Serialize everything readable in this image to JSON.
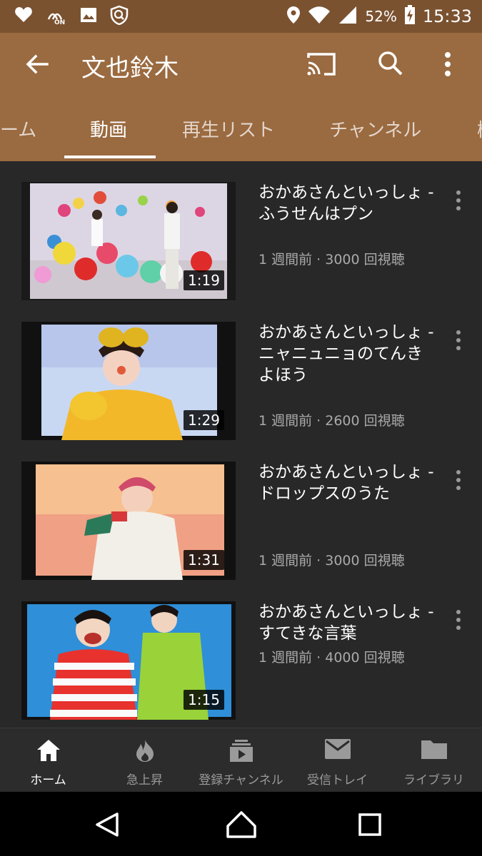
{
  "status_bar": {
    "icons": [
      "heart-icon",
      "nfc-on-icon",
      "image-icon",
      "vpn-shield-icon",
      "location-icon",
      "wifi-icon",
      "signal-icon",
      "battery-icon"
    ],
    "nfc_label": "ON",
    "battery": "52%",
    "time": "15:33"
  },
  "app_bar": {
    "title": "文也鈴木",
    "icons": [
      "back-arrow-icon",
      "cast-icon",
      "search-icon",
      "more-vert-icon"
    ]
  },
  "tabs": [
    {
      "label": "ーム",
      "active": false
    },
    {
      "label": "動画",
      "active": true
    },
    {
      "label": "再生リスト",
      "active": false
    },
    {
      "label": "チャンネル",
      "active": false
    },
    {
      "label": "概",
      "active": false
    }
  ],
  "videos": [
    {
      "title": "おかあさんといっしょ - ふうせんはプン",
      "meta": "1 週間前 · 3000 回視聴",
      "duration": "1:19"
    },
    {
      "title": "おかあさんといっしょ - ニャニュニョのてんきよほう",
      "meta": "1 週間前 · 2600 回視聴",
      "duration": "1:29"
    },
    {
      "title": "おかあさんといっしょ - ドロップスのうた",
      "meta": "1 週間前 · 3000 回視聴",
      "duration": "1:31"
    },
    {
      "title": "おかあさんといっしょ - すてきな言葉",
      "meta": "1 週間前 · 4000 回視聴",
      "duration": "1:15"
    }
  ],
  "bottom_nav": [
    {
      "label": "ホーム",
      "icon": "home-icon",
      "active": true
    },
    {
      "label": "急上昇",
      "icon": "fire-icon",
      "active": false
    },
    {
      "label": "登録チャンネル",
      "icon": "subscriptions-icon",
      "active": false
    },
    {
      "label": "受信トレイ",
      "icon": "mail-icon",
      "active": false
    },
    {
      "label": "ライブラリ",
      "icon": "folder-icon",
      "active": false
    }
  ],
  "system_nav": [
    "back-triangle-icon",
    "home-circle-icon",
    "recents-square-icon"
  ],
  "colors": {
    "status_bar": "#7a5230",
    "app_bar": "#9a6a40",
    "background": "#282828",
    "secondary_text": "#aaaaaa"
  }
}
